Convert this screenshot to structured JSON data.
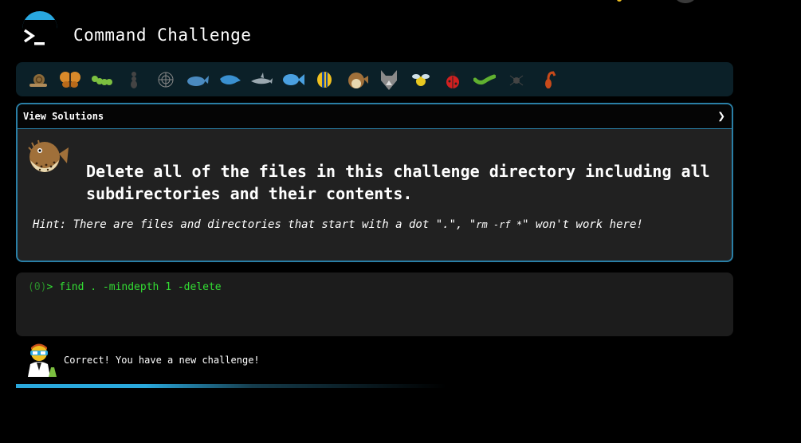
{
  "header": {
    "title": "Command Challenge",
    "logo_icon": "terminal-prompt-icon"
  },
  "levels": {
    "items": [
      {
        "icon": "snail-icon"
      },
      {
        "icon": "butterfly-icon"
      },
      {
        "icon": "caterpillar-icon"
      },
      {
        "icon": "ant-icon"
      },
      {
        "icon": "spider-web-icon"
      },
      {
        "icon": "whale-icon"
      },
      {
        "icon": "dolphin-icon"
      },
      {
        "icon": "shark-icon"
      },
      {
        "icon": "fish-icon"
      },
      {
        "icon": "tropical-fish-icon"
      },
      {
        "icon": "pufferfish-icon"
      },
      {
        "icon": "wolf-icon"
      },
      {
        "icon": "bee-icon"
      },
      {
        "icon": "ladybug-icon"
      },
      {
        "icon": "worm-icon"
      },
      {
        "icon": "spider-icon"
      },
      {
        "icon": "scorpion-icon"
      }
    ]
  },
  "challenge": {
    "view_solutions_label": "View Solutions",
    "chevron": "❯",
    "text": "Delete all of the files in this challenge directory including all subdirectories and their contents.",
    "hint_prefix": "Hint: There are files and directories that start with a dot \".\", \"",
    "hint_code": "rm -rf *",
    "hint_suffix": "\" won't work here!"
  },
  "terminal": {
    "exit_code": "(0)",
    "prompt_symbol": ">",
    "command": "find . -mindepth 1 -delete"
  },
  "result": {
    "message": "Correct! You have a new challenge!"
  },
  "progress": {
    "percent": 60
  },
  "colors": {
    "accent": "#2aa8dc",
    "prompt_green": "#33dd33",
    "panel_border": "#2a7fa6"
  }
}
